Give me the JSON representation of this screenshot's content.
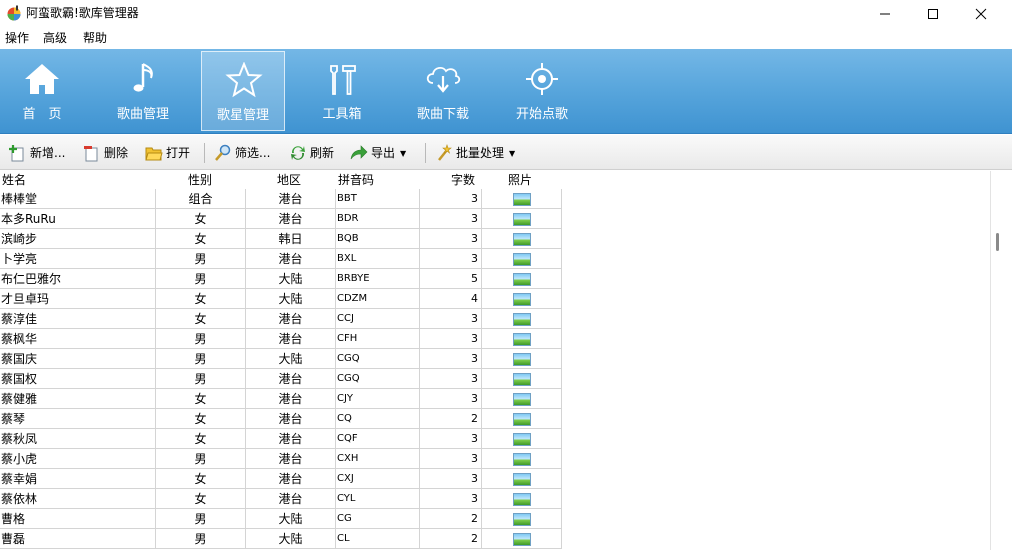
{
  "window": {
    "title": "阿蛮歌霸!歌库管理器",
    "controls": {
      "minimize": "—",
      "maximize": "☐",
      "close": "✕"
    }
  },
  "menu": [
    "操作",
    "高级",
    "帮助"
  ],
  "nav": [
    {
      "label": "首　页",
      "icon": "home-icon"
    },
    {
      "label": "歌曲管理",
      "icon": "music-note-icon"
    },
    {
      "label": "歌星管理",
      "icon": "star-icon",
      "active": true
    },
    {
      "label": "工具箱",
      "icon": "tools-icon"
    },
    {
      "label": "歌曲下载",
      "icon": "cloud-download-icon"
    },
    {
      "label": "开始点歌",
      "icon": "target-icon"
    }
  ],
  "toolbar": {
    "add": "新增...",
    "delete": "删除",
    "open": "打开",
    "filter": "筛选...",
    "refresh": "刷新",
    "export": "导出",
    "batch": "批量处理"
  },
  "table": {
    "headers": [
      "姓名",
      "性别",
      "地区",
      "拼音码",
      "字数",
      "照片"
    ],
    "rows": [
      [
        "棒棒堂",
        "组合",
        "港台",
        "BBT",
        "3"
      ],
      [
        "本多RuRu",
        "女",
        "港台",
        "BDR",
        "3"
      ],
      [
        "滨崎步",
        "女",
        "韩日",
        "BQB",
        "3"
      ],
      [
        "卜学亮",
        "男",
        "港台",
        "BXL",
        "3"
      ],
      [
        "布仁巴雅尔",
        "男",
        "大陆",
        "BRBYE",
        "5"
      ],
      [
        "才旦卓玛",
        "女",
        "大陆",
        "CDZM",
        "4"
      ],
      [
        "蔡淳佳",
        "女",
        "港台",
        "CCJ",
        "3"
      ],
      [
        "蔡枫华",
        "男",
        "港台",
        "CFH",
        "3"
      ],
      [
        "蔡国庆",
        "男",
        "大陆",
        "CGQ",
        "3"
      ],
      [
        "蔡国权",
        "男",
        "港台",
        "CGQ",
        "3"
      ],
      [
        "蔡健雅",
        "女",
        "港台",
        "CJY",
        "3"
      ],
      [
        "蔡琴",
        "女",
        "港台",
        "CQ",
        "2"
      ],
      [
        "蔡秋凤",
        "女",
        "港台",
        "CQF",
        "3"
      ],
      [
        "蔡小虎",
        "男",
        "港台",
        "CXH",
        "3"
      ],
      [
        "蔡幸娟",
        "女",
        "港台",
        "CXJ",
        "3"
      ],
      [
        "蔡依林",
        "女",
        "港台",
        "CYL",
        "3"
      ],
      [
        "曹格",
        "男",
        "大陆",
        "CG",
        "2"
      ],
      [
        "曹磊",
        "男",
        "大陆",
        "CL",
        "2"
      ]
    ]
  },
  "colors": {
    "toolbar_blue": "#5aa7dd",
    "grid_line": "#d4d4d4"
  }
}
